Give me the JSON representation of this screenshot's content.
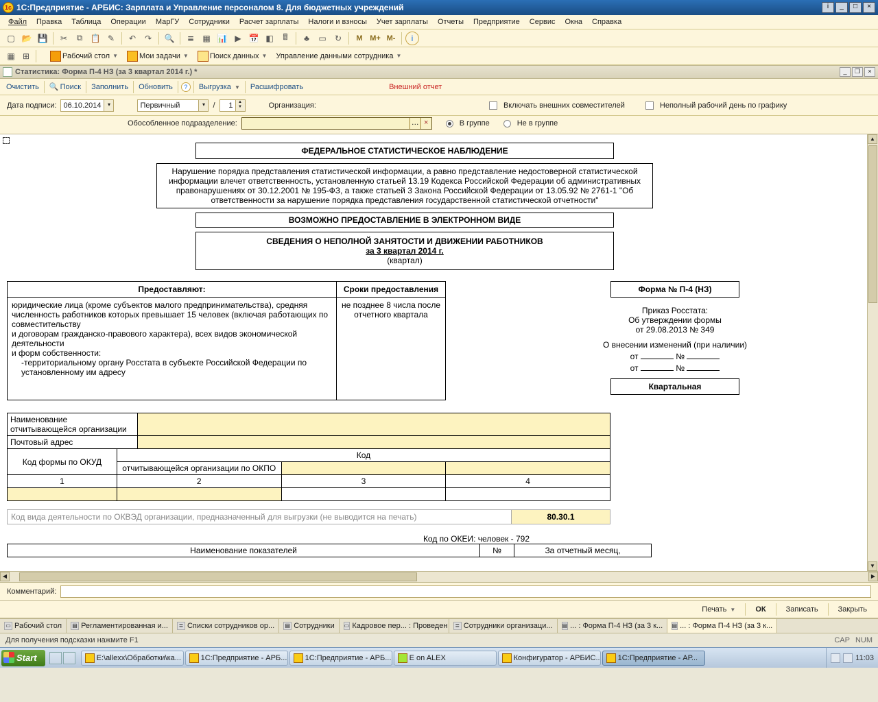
{
  "window": {
    "title": "1С:Предприятие - АРБИС: Зарплата и Управление персоналом 8. Для бюджетных учреждений"
  },
  "menu": [
    "Файл",
    "Правка",
    "Таблица",
    "Операции",
    "МарГУ",
    "Сотрудники",
    "Расчет зарплаты",
    "Налоги и взносы",
    "Учет зарплаты",
    "Отчеты",
    "Предприятие",
    "Сервис",
    "Окна",
    "Справка"
  ],
  "toolbar2": {
    "desktop": "Рабочий стол",
    "tasks": "Мои задачи",
    "search": "Поиск данных",
    "manage": "Управление данными сотрудника"
  },
  "subwindow": {
    "title": "Статистика: Форма П-4 НЗ (за 3 квартал 2014 г.) *"
  },
  "doc_toolbar": {
    "clear": "Очистить",
    "find": "Поиск",
    "fill": "Заполнить",
    "refresh": "Обновить",
    "export": "Выгрузка",
    "decode": "Расшифровать",
    "external": "Внешний отчет"
  },
  "filters": {
    "sign_date_label": "Дата подписи:",
    "sign_date": "06.10.2014",
    "primary": "Первичный",
    "number": "1",
    "org_label": "Организация:",
    "subdiv_label": "Обособленное подразделение:",
    "include_ext": "Включать внешних совместителей",
    "parttime": "Неполный рабочий день по графику",
    "in_group": "В группе",
    "not_in_group": "Не в группе"
  },
  "report": {
    "header": "ФЕДЕРАЛЬНОЕ СТАТИСТИЧЕСКОЕ НАБЛЮДЕНИЕ",
    "notice": "Нарушение порядка представления статистической информации, а равно представление недостоверной статистической информации влечет ответственность, установленную статьей 13.19 Кодекса Российской Федерации об административных правонарушениях от 30.12.2001 № 195-ФЗ, а также статьей 3 Закона Российской Федерации от 13.05.92 № 2761-1 \"Об ответственности за нарушение порядка представления государственной статистической отчетности\"",
    "electronic": "ВОЗМОЖНО ПРЕДОСТАВЛЕНИЕ В ЭЛЕКТРОННОМ ВИДЕ",
    "main_title": "СВЕДЕНИЯ О НЕПОЛНОЙ ЗАНЯТОСТИ И ДВИЖЕНИИ РАБОТНИКОВ",
    "period": "за 3 квартал 2014 г.",
    "period_sub": "(квартал)",
    "present_col": "Предоставляют:",
    "deadline_col": "Сроки предоставления",
    "present_body_1": "юридические лица (кроме субъектов малого предпринимательства), средняя численность работников которых превышает 15 человек (включая работающих по совместительству",
    "present_body_2": "и договорам гражданско-правового характера), всех видов экономической деятельности",
    "present_body_3": "и форм собственности:",
    "present_body_4": "-территориальному органу Росстата в субъекте Российской Федерации по установленному им адресу",
    "deadline_body": "не позднее 8 числа после отчетного квартала",
    "form_no": "Форма № П-4 (НЗ)",
    "order1": "Приказ Росстата:",
    "order2": "Об утверждении формы",
    "order3": "от 29.08.2013 № 349",
    "changes": "О внесении изменений (при наличии)",
    "from": "от",
    "no": "№",
    "quarterly": "Квартальная",
    "org_name_label": "Наименование отчитывающейся организации",
    "address_label": "Почтовый адрес",
    "code_form_label": "Код формы по ОКУД",
    "code_caption": "Код",
    "code_okpo": "отчитывающейся организации по ОКПО",
    "c1": "1",
    "c2": "2",
    "c3": "3",
    "c4": "4",
    "okved_label": "Код вида деятельности по ОКВЭД организации, предназначенный для выгрузки (не выводится на печать)",
    "okved_value": "80.30.1",
    "okei": "Код по ОКЕИ: человек - 792",
    "metric_name": "Наименование показателей",
    "col_no": "№",
    "col_month": "За отчетный месяц,"
  },
  "comment_label": "Комментарий:",
  "actions": {
    "print": "Печать",
    "ok": "ОК",
    "write": "Записать",
    "close": "Закрыть"
  },
  "tabs": [
    {
      "label": "Рабочий стол",
      "active": false
    },
    {
      "label": "Регламентированная и...",
      "active": false
    },
    {
      "label": "Списки сотрудников ор...",
      "active": false
    },
    {
      "label": "Сотрудники",
      "active": false
    },
    {
      "label": "Кадровое пер... : Проведен",
      "active": false
    },
    {
      "label": "Сотрудники организаци...",
      "active": false
    },
    {
      "label": "... : Форма П-4 НЗ (за 3 к...",
      "active": false
    },
    {
      "label": "... : Форма П-4 НЗ (за 3 к...",
      "active": true
    }
  ],
  "status": {
    "hint": "Для получения подсказки нажмите F1",
    "cap": "CAP",
    "num": "NUM"
  },
  "taskbar": {
    "start": "Start",
    "items": [
      "E:\\allexx\\Обработки\\ка...",
      "1С:Предприятие - АРБ...",
      "1С:Предприятие - АРБ...",
      "E on ALEX",
      "Конфигуратор - АРБИС...",
      "1С:Предприятие - АР..."
    ],
    "time": "11:03"
  }
}
